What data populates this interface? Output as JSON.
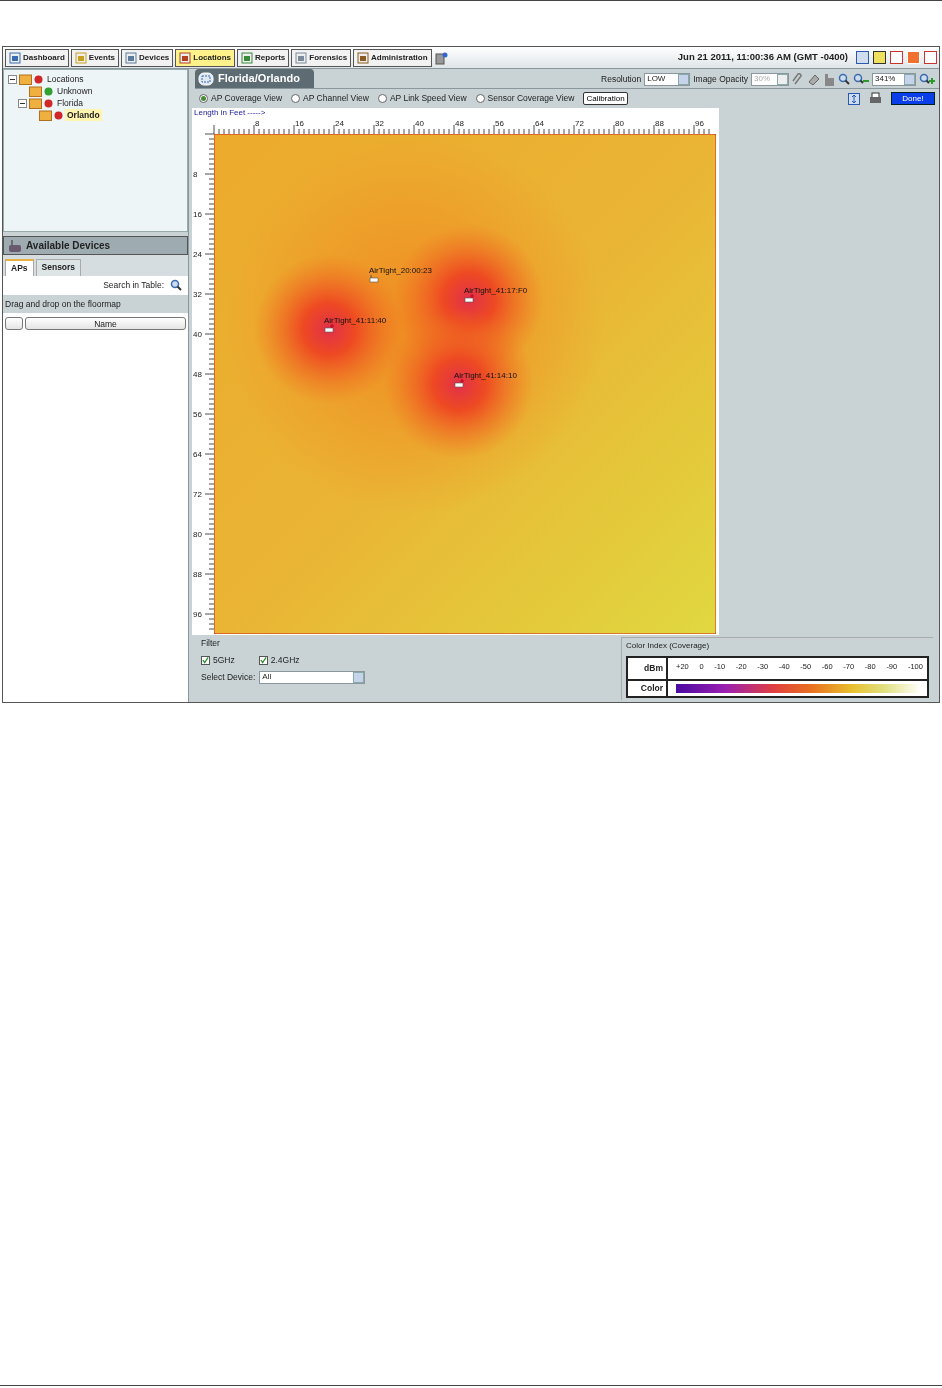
{
  "nav": [
    {
      "label": "Dashboard",
      "selected": false
    },
    {
      "label": "Events",
      "selected": false
    },
    {
      "label": "Devices",
      "selected": false
    },
    {
      "label": "Locations",
      "selected": true
    },
    {
      "label": "Reports",
      "selected": false
    },
    {
      "label": "Forensics",
      "selected": false
    },
    {
      "label": "Administration",
      "selected": false
    }
  ],
  "timestamp": "Jun 21 2011, 11:00:36 AM (GMT -0400)",
  "tree": [
    {
      "label": "Locations",
      "color": "#d02828",
      "selected": false,
      "expanded": true,
      "children": [
        {
          "label": "Unknown",
          "color": "#30a030",
          "selected": false
        },
        {
          "label": "Florida",
          "color": "#d02828",
          "selected": false,
          "expanded": true,
          "children": [
            {
              "label": "Orlando",
              "color": "#d02828",
              "selected": true
            }
          ]
        }
      ]
    }
  ],
  "devices_panel": {
    "title": "Available Devices",
    "tabs": [
      {
        "label": "APs",
        "selected": true
      },
      {
        "label": "Sensors",
        "selected": false
      }
    ],
    "search_label": "Search in Table:",
    "hint": "Drag and drop on the floormap",
    "columns": [
      "Name"
    ]
  },
  "map": {
    "title": "Florida/Orlando",
    "resolution_label": "Resolution",
    "resolution": "LOW",
    "opacity_label": "Image Opacity",
    "opacity": "30%",
    "zoom": "341%",
    "views": [
      {
        "label": "AP Coverage View",
        "selected": true
      },
      {
        "label": "AP Channel View",
        "selected": false
      },
      {
        "label": "AP Link Speed View",
        "selected": false
      },
      {
        "label": "Sensor Coverage View",
        "selected": false
      }
    ],
    "calibration": "Calibration",
    "done": "Done!",
    "ruler_label": "Length in Feet ----->",
    "xticks": [
      "8",
      "16",
      "24",
      "32",
      "40",
      "48",
      "56",
      "64",
      "72",
      "80",
      "88",
      "96"
    ],
    "yticks": [
      "8",
      "16",
      "24",
      "32",
      "40",
      "48",
      "56",
      "64",
      "72",
      "80",
      "88",
      "96"
    ],
    "aps": [
      {
        "label": "AirTight_20:00:23",
        "radiating": false
      },
      {
        "label": "AirTight_41:17:F0",
        "radiating": true
      },
      {
        "label": "AirTight_41:11:40",
        "radiating": true
      },
      {
        "label": "AirTight_41:14:10",
        "radiating": true
      }
    ]
  },
  "filter": {
    "title": "Filter",
    "bands": [
      {
        "label": "5GHz",
        "checked": true
      },
      {
        "label": "2.4GHz",
        "checked": true
      }
    ],
    "device_label": "Select Device:",
    "device": "All"
  },
  "legend": {
    "title": "Color Index (Coverage)",
    "row_labels": [
      "dBm",
      "Color"
    ],
    "ticks": [
      "+20",
      "0",
      "-10",
      "-20",
      "-30",
      "-40",
      "-50",
      "-60",
      "-70",
      "-80",
      "-90",
      "-100"
    ]
  }
}
